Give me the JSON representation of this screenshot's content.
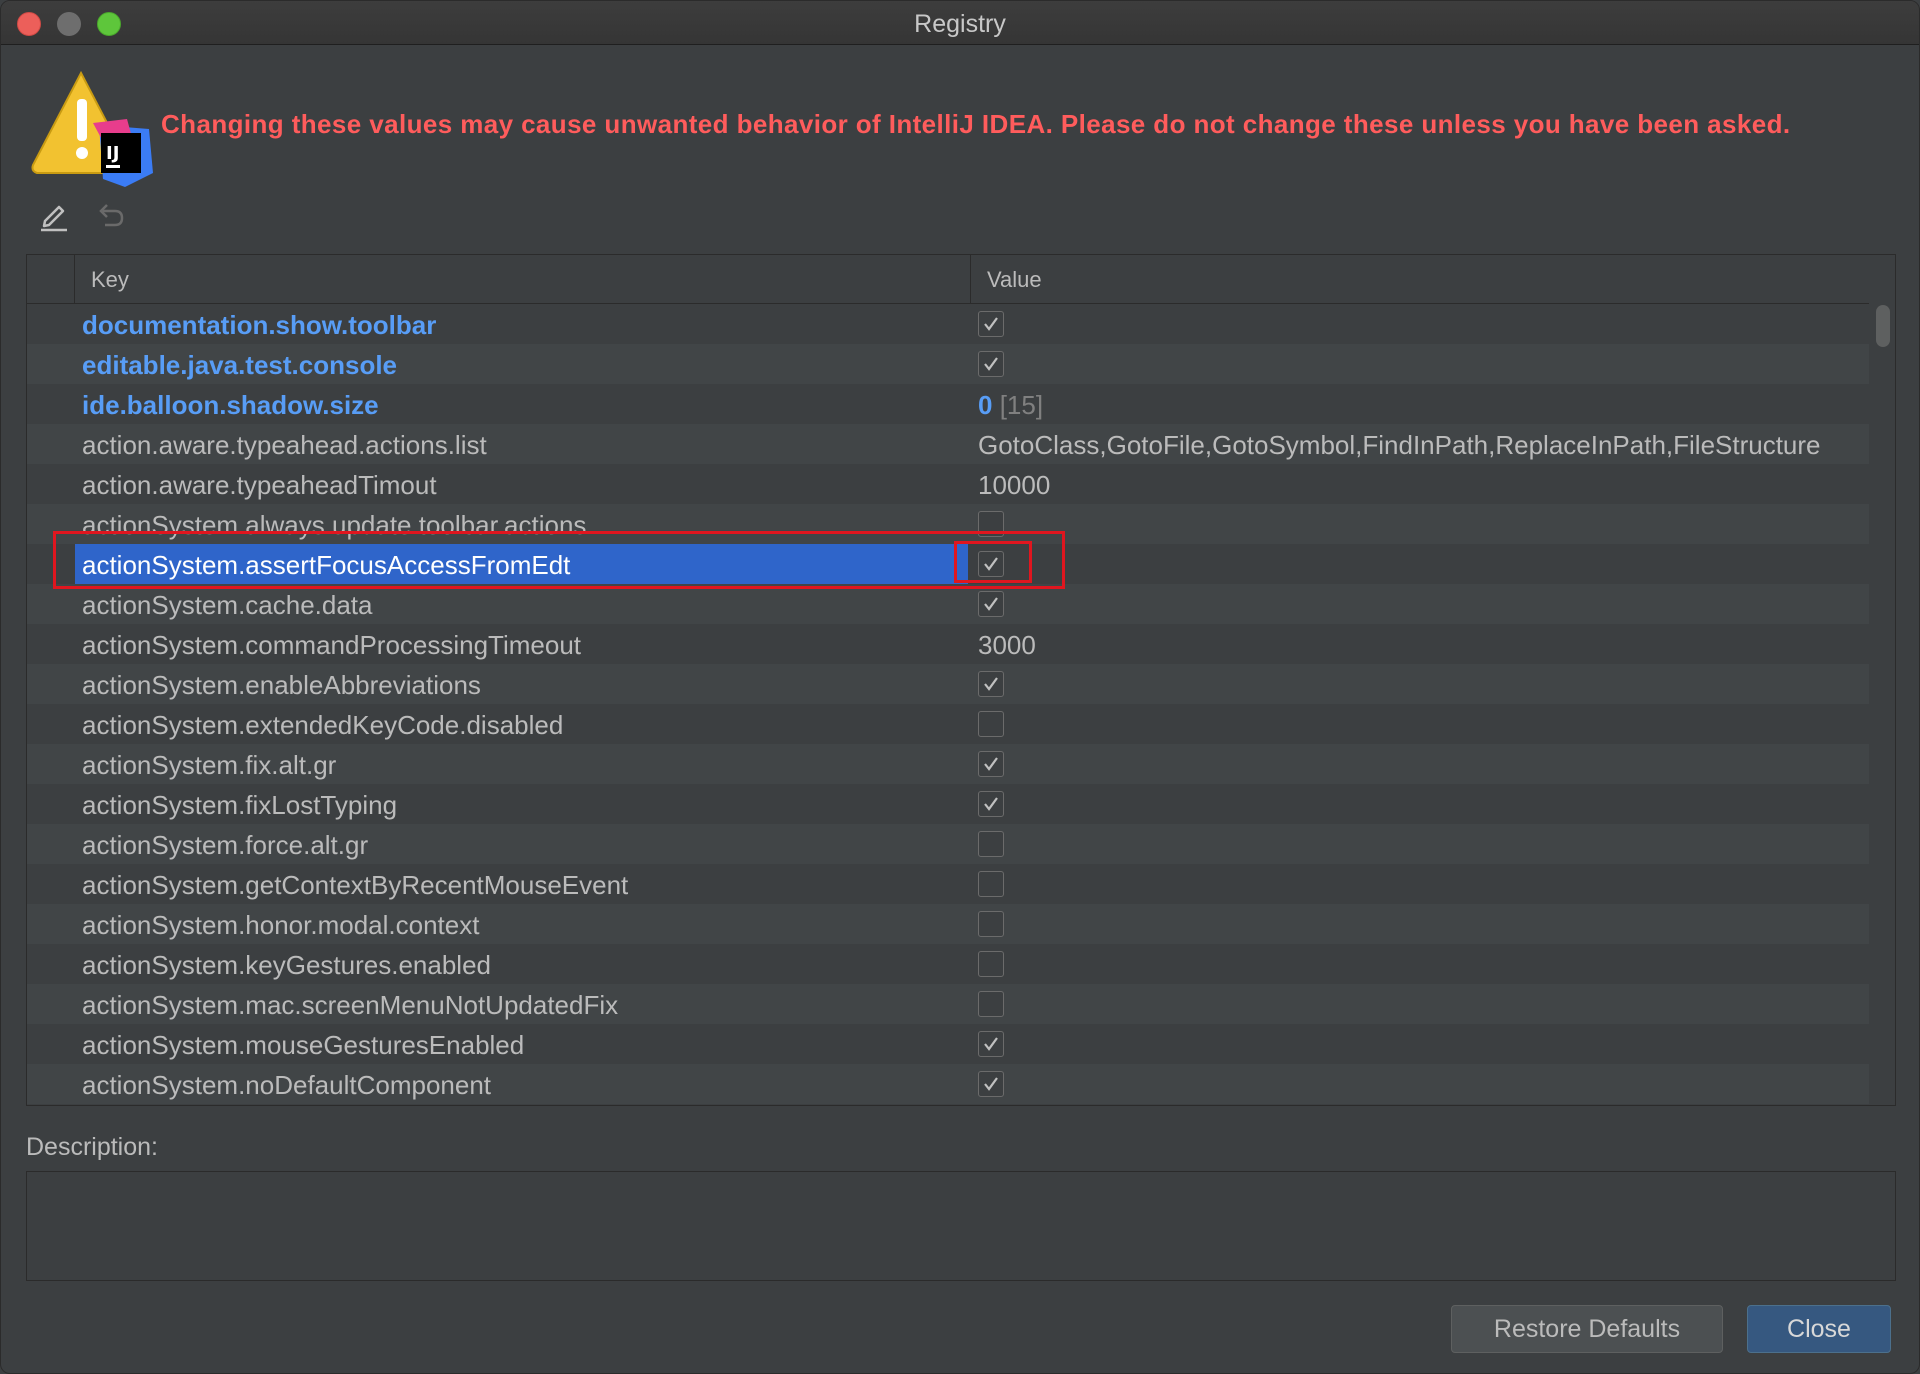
{
  "window": {
    "title": "Registry"
  },
  "warning": {
    "text": "Changing these values may cause unwanted behavior of IntelliJ IDEA. Please do not change these unless you have been asked.",
    "icon": "warning-intellij-icon",
    "icon_text": "IJ"
  },
  "toolbar": {
    "edit_icon": "pencil-icon",
    "revert_icon": "undo-icon"
  },
  "table": {
    "columns": {
      "key": "Key",
      "value": "Value"
    },
    "rows": [
      {
        "key": "documentation.show.toolbar",
        "type": "bool",
        "checked": true,
        "modified": true
      },
      {
        "key": "editable.java.test.console",
        "type": "bool",
        "checked": true,
        "modified": true
      },
      {
        "key": "ide.balloon.shadow.size",
        "type": "number",
        "value": "0",
        "default": "[15]",
        "modified": true
      },
      {
        "key": "action.aware.typeahead.actions.list",
        "type": "text",
        "value": "GotoClass,GotoFile,GotoSymbol,FindInPath,ReplaceInPath,FileStructure"
      },
      {
        "key": "action.aware.typeaheadTimout",
        "type": "text",
        "value": "10000"
      },
      {
        "key": "actionSystem.always.update.toolbar.actions",
        "type": "bool",
        "checked": false
      },
      {
        "key": "actionSystem.assertFocusAccessFromEdt",
        "type": "bool",
        "checked": true,
        "selected": true
      },
      {
        "key": "actionSystem.cache.data",
        "type": "bool",
        "checked": true
      },
      {
        "key": "actionSystem.commandProcessingTimeout",
        "type": "text",
        "value": "3000"
      },
      {
        "key": "actionSystem.enableAbbreviations",
        "type": "bool",
        "checked": true
      },
      {
        "key": "actionSystem.extendedKeyCode.disabled",
        "type": "bool",
        "checked": false
      },
      {
        "key": "actionSystem.fix.alt.gr",
        "type": "bool",
        "checked": true
      },
      {
        "key": "actionSystem.fixLostTyping",
        "type": "bool",
        "checked": true
      },
      {
        "key": "actionSystem.force.alt.gr",
        "type": "bool",
        "checked": false
      },
      {
        "key": "actionSystem.getContextByRecentMouseEvent",
        "type": "bool",
        "checked": false
      },
      {
        "key": "actionSystem.honor.modal.context",
        "type": "bool",
        "checked": false
      },
      {
        "key": "actionSystem.keyGestures.enabled",
        "type": "bool",
        "checked": false
      },
      {
        "key": "actionSystem.mac.screenMenuNotUpdatedFix",
        "type": "bool",
        "checked": false
      },
      {
        "key": "actionSystem.mouseGesturesEnabled",
        "type": "bool",
        "checked": true
      },
      {
        "key": "actionSystem.noDefaultComponent",
        "type": "bool",
        "checked": true
      }
    ]
  },
  "description": {
    "label": "Description:",
    "text": ""
  },
  "buttons": {
    "restore": "Restore Defaults",
    "close": "Close"
  },
  "colors": {
    "warning": "#ff5c5c",
    "modified_key": "#589df6",
    "selection": "#2f65ca",
    "highlight": "#e0161f"
  }
}
